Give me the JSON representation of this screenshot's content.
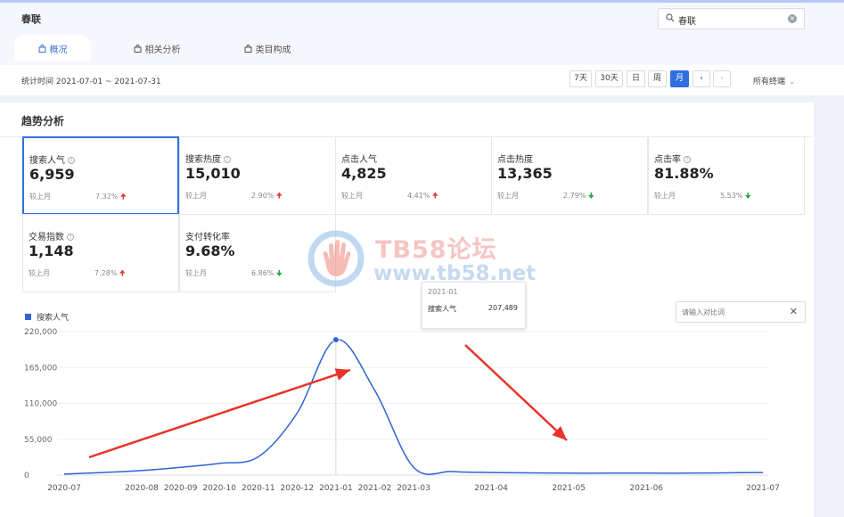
{
  "page": {
    "title": "春联"
  },
  "search": {
    "value": "春联"
  },
  "tabs": [
    {
      "label": "概况",
      "active": true
    },
    {
      "label": "相关分析",
      "active": false
    },
    {
      "label": "类目构成",
      "active": false
    }
  ],
  "period": {
    "range_text": "统计时间 2021-07-01 ~ 2021-07-31",
    "buttons": [
      "7天",
      "30天",
      "日",
      "周",
      "月"
    ],
    "active_button": "月",
    "prev_icon": "chevron-left-icon",
    "next_icon": "chevron-right-icon",
    "terminal_label": "所有终端"
  },
  "section": {
    "title": "趋势分析"
  },
  "metrics": [
    {
      "label": "搜索人气",
      "help": true,
      "value": "6,959",
      "compare_label": "较上月",
      "pct": "7.32%",
      "direction": "up",
      "selected": true
    },
    {
      "label": "搜索热度",
      "help": true,
      "value": "15,010",
      "compare_label": "较上月",
      "pct": "2.90%",
      "direction": "up",
      "selected": false
    },
    {
      "label": "点击人气",
      "help": false,
      "value": "4,825",
      "compare_label": "较上月",
      "pct": "4.41%",
      "direction": "up",
      "selected": false
    },
    {
      "label": "点击热度",
      "help": false,
      "value": "13,365",
      "compare_label": "较上月",
      "pct": "2.79%",
      "direction": "down",
      "selected": false
    },
    {
      "label": "点击率",
      "help": true,
      "value": "81.88%",
      "compare_label": "较上月",
      "pct": "5.53%",
      "direction": "down",
      "selected": false
    },
    {
      "label": "交易指数",
      "help": true,
      "value": "1,148",
      "compare_label": "较上月",
      "pct": "7.28%",
      "direction": "up",
      "selected": false
    },
    {
      "label": "支付转化率",
      "help": false,
      "value": "9.68%",
      "compare_label": "较上月",
      "pct": "6.86%",
      "direction": "down",
      "selected": false
    }
  ],
  "compare": {
    "placeholder": "请输入对比词"
  },
  "watermark": {
    "line1": "TB58论坛",
    "line2": "www.tb58.net"
  },
  "colors": {
    "accent": "#2f6fe0",
    "line": "#2f63d6",
    "up": "#e5392c",
    "down": "#22a34c",
    "annotation_arrow": "#e8332a"
  },
  "chart_data": {
    "type": "line",
    "legend": [
      "搜索人气"
    ],
    "series": [
      {
        "name": "搜索人气",
        "values": [
          1500,
          4000,
          7000,
          12000,
          18000,
          28000,
          95000,
          207489,
          130000,
          12000,
          5500,
          4000,
          3500,
          3000,
          3000,
          3000,
          3000,
          3500,
          4000
        ]
      }
    ],
    "x": [
      "2020-07",
      "",
      "2020-08",
      "2020-09",
      "2020-10",
      "2020-11",
      "2020-12",
      "2021-01",
      "2021-02",
      "2021-03",
      "",
      "2021-04",
      "",
      "2021-05",
      "",
      "2021-06",
      "",
      "",
      "2021-07"
    ],
    "x_tick_labels": [
      "2020-07",
      "2020-08",
      "2020-09",
      "2020-10",
      "2020-11",
      "2020-12",
      "2021-01",
      "2021-02",
      "2021-03",
      "2021-04",
      "2021-05",
      "2021-06",
      "2021-07"
    ],
    "y_tick_labels": [
      "0",
      "55,000",
      "110,000",
      "165,000",
      "220,000"
    ],
    "ylim": [
      0,
      220000
    ],
    "grid": true,
    "tooltip": {
      "title": "2021-01",
      "series": "搜索人气",
      "value": "207,489"
    }
  }
}
